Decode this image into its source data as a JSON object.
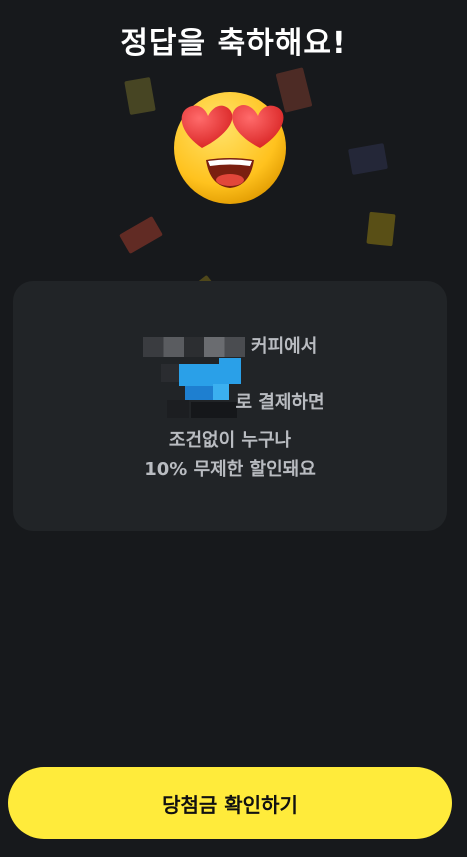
{
  "title": "정답을 축하해요!",
  "emoji_icon": "heart-eyes-emoji-icon",
  "message": {
    "line1_suffix": "커피에서",
    "line2_suffix": "로 결제하면",
    "line3": "조건없이 누구나",
    "line4": "10% 무제한 할인돼요"
  },
  "cta": {
    "label": "당첨금 확인하기",
    "color": "#ffeb3b"
  },
  "colors": {
    "background": "#17191c",
    "card": "#212427"
  }
}
